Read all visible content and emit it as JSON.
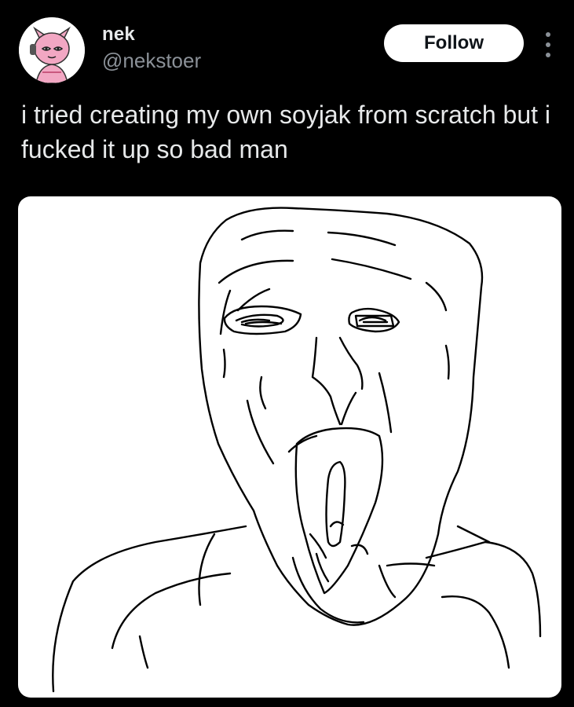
{
  "tweet": {
    "author": {
      "display_name": "nek",
      "handle": "@nekstoer",
      "avatar_icon": "pink-character-avatar"
    },
    "follow_label": "Follow",
    "more_icon": "vertical-ellipsis-icon",
    "text": "i tried creating my own soyjak from scratch but i fucked it up so bad man",
    "media": {
      "type": "image",
      "content": "hand-drawn soyjak face sketch"
    }
  },
  "colors": {
    "background": "#000000",
    "primary_text": "#e7e9ea",
    "secondary_text": "#8b9198",
    "follow_button_bg": "#ffffff",
    "follow_button_text": "#0f1419",
    "media_bg": "#ffffff",
    "avatar_pink": "#f2a7c3"
  }
}
